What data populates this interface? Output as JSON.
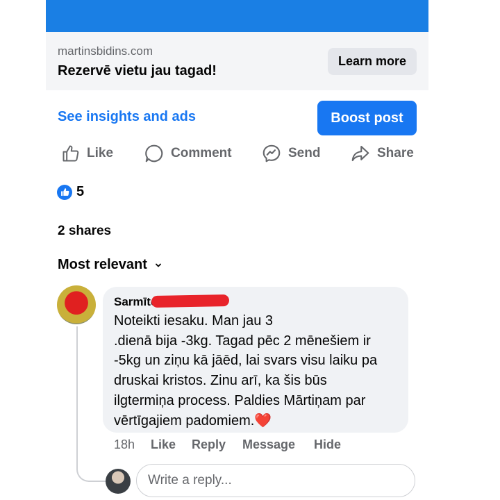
{
  "colors": {
    "accent": "#1877f2",
    "banner": "#1a7fe4",
    "muted_text": "#65676b",
    "heart": "#e0245e",
    "redaction": "#e8232a"
  },
  "link_preview": {
    "domain": "martinsbidins.com",
    "headline": "Rezervē vietu jau tagad!",
    "cta_label": "Learn more"
  },
  "post_tools": {
    "insights_label": "See insights and ads",
    "boost_label": "Boost post"
  },
  "actions": [
    {
      "label": "Like",
      "icon": "thumbs-up-icon"
    },
    {
      "label": "Comment",
      "icon": "comment-bubble-icon"
    },
    {
      "label": "Send",
      "icon": "messenger-icon"
    },
    {
      "label": "Share",
      "icon": "share-arrow-icon"
    }
  ],
  "reactions": {
    "count": "5",
    "icon": "like-badge-icon"
  },
  "shares_label": "2 shares",
  "sort": {
    "label": "Most relevant",
    "icon": "chevron-down-icon"
  },
  "comment": {
    "author": "Sarmīte",
    "text": "Noteikti iesaku. Man jau 3\n.dienā bija -3kg. Tagad pēc 2 mēnešiem ir\n-5kg un ziņu kā jāēd, lai svars visu laiku pa\ndruskai kristos. Zinu arī, ka šis būs\nilgtermiņa process. Paldies Mārtiņam par\nvērtīgajiem padomiem.",
    "emoji": "❤️",
    "time": "18h",
    "like_label": "Like",
    "reply_label": "Reply",
    "message_label": "Message",
    "hide_label": "Hide"
  },
  "reply_box": {
    "placeholder": "Write a reply..."
  }
}
